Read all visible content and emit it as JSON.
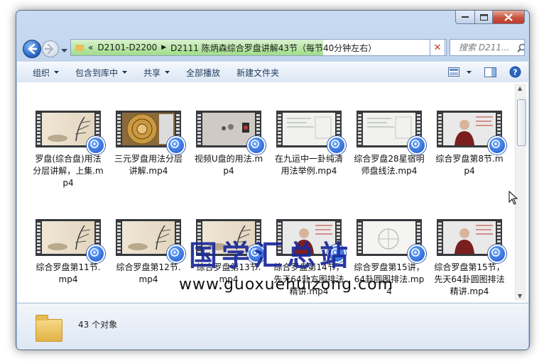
{
  "window": {
    "caption_buttons": [
      "minimize-icon",
      "maximize-icon",
      "close-icon"
    ]
  },
  "address_bar": {
    "overflow": "«",
    "segments": [
      "D2101-D2200",
      "D2111 陈炳森综合罗盘讲解43节（每节40分钟左右）"
    ]
  },
  "search": {
    "placeholder": "搜索 D211..."
  },
  "toolbar": {
    "organize": "组织",
    "include_in_library": "包含到库中",
    "share": "共享",
    "play_all": "全部播放",
    "new_folder": "新建文件夹"
  },
  "files": [
    {
      "name": "罗盘(综合盘)用法分层讲解，上集.mp4",
      "thumb": "ink-painting"
    },
    {
      "name": "三元罗盘用法分层讲解.mp4",
      "thumb": "compass"
    },
    {
      "name": "视频U盘的用法.mp4",
      "thumb": "objects"
    },
    {
      "name": "在九运中一卦纯清用法举例.mp4",
      "thumb": "whiteboard"
    },
    {
      "name": "综合罗盘28星宿明师盘线法.mp4",
      "thumb": "whiteboard"
    },
    {
      "name": "综合罗盘第8节.mp4",
      "thumb": "presenter"
    },
    {
      "name": "综合罗盘第11节.mp4",
      "thumb": "ink-painting"
    },
    {
      "name": "综合罗盘第12节.mp4",
      "thumb": "ink-painting"
    },
    {
      "name": "综合罗盘第13节.mp4",
      "thumb": "ink-painting"
    },
    {
      "name": "综合罗盘第14节，先天64卦方图排法精讲.mp4",
      "thumb": "presenter"
    },
    {
      "name": "综合罗盘第15讲，64卦圆图排法.mp4",
      "thumb": "paper"
    },
    {
      "name": "综合罗盘第15节，先天64卦圆图排法精讲.mp4",
      "thumb": "presenter"
    }
  ],
  "watermark": {
    "title": "国学汇总站",
    "url": "www.guoxuehuizong.com"
  },
  "details": {
    "count": "43 个对象"
  },
  "colors": {
    "address_highlight": "#9fdd88",
    "watermark_title": "#1c2a9a",
    "media_badge": "#1a55c8"
  }
}
